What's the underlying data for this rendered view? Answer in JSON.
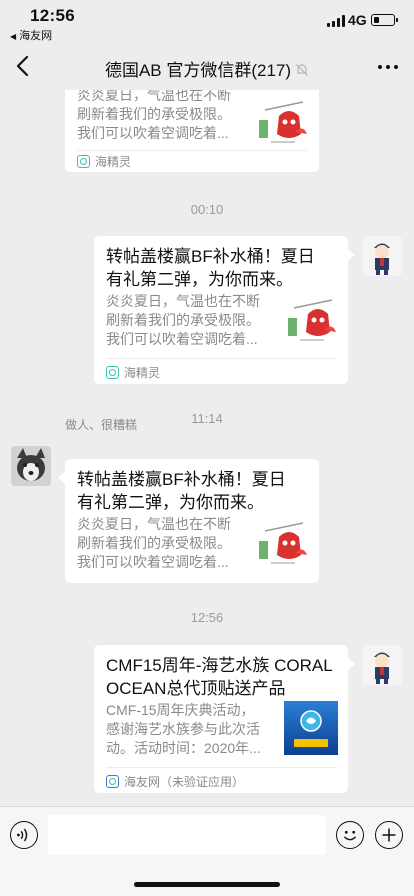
{
  "status_bar": {
    "time": "12:56",
    "back_app": "海友网",
    "network": "4G",
    "battery_level": 0.3
  },
  "nav": {
    "title": "德国AB 官方微信群(217)",
    "muted": true
  },
  "messages": [
    {
      "id": "m1",
      "title": "",
      "desc": "炎炎夏日，气温也在不断刷新着我们的承受极限。我们可以吹着空调吃着...",
      "desc_lines": [
        "炎炎夏日，气温也在不断",
        "刷新着我们的承受极限。",
        "我们可以吹着空调吃着..."
      ],
      "source": "海精灵"
    },
    {
      "id": "m2",
      "time": "00:10",
      "title_lines": [
        "转帖盖楼赢BF补水桶！夏日",
        "有礼第二弹，为你而来。"
      ],
      "desc_lines": [
        "炎炎夏日，气温也在不断",
        "刷新着我们的承受极限。",
        "我们可以吹着空调吃着..."
      ],
      "source": "海精灵"
    },
    {
      "id": "m3",
      "time": "11:14",
      "sender": "做人、很糟糕",
      "title_lines": [
        "转帖盖楼赢BF补水桶！夏日",
        "有礼第二弹，为你而来。"
      ],
      "desc_lines": [
        "炎炎夏日，气温也在不断",
        "刷新着我们的承受极限。",
        "我们可以吹着空调吃着..."
      ]
    },
    {
      "id": "m4",
      "time": "12:56",
      "title_lines": [
        "CMF15周年-海艺水族 CORAL",
        "OCEAN总代顶贴送产品"
      ],
      "desc_lines": [
        "CMF-15周年庆典活动，",
        "感谢海艺水族参与此次活",
        "动。活动时间：2020年..."
      ],
      "source": "海友网（未验证应用）"
    }
  ],
  "colors": {
    "background": "#ededed",
    "card": "#ffffff",
    "timestamp": "#9a9a9a",
    "source_icon": "#3fbfb0"
  }
}
